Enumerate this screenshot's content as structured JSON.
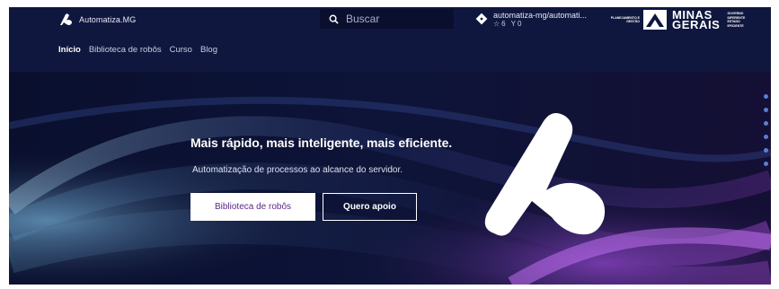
{
  "header": {
    "logo_text": "Automatiza.MG",
    "search": {
      "placeholder": "Buscar"
    },
    "repo": {
      "name": "automatiza-mg/automati...",
      "stars": "6",
      "forks": "0"
    },
    "partner": {
      "plan_text": "PLANEJAMENTO E GESTÃO",
      "brand_line1": "MINAS",
      "brand_line2": "GERAIS",
      "gov_text": "GOVERNO DIFERENTE ESTADO EFICIENTE"
    }
  },
  "nav": {
    "items": [
      {
        "label": "Início",
        "active": true
      },
      {
        "label": "Biblioteca de robôs"
      },
      {
        "label": "Curso"
      },
      {
        "label": "Blog"
      }
    ]
  },
  "hero": {
    "title": "Mais rápido, mais inteligente, mais eficiente.",
    "subtitle": "Automatização de processos ao alcance do servidor.",
    "primary_button": "Biblioteca de robôs",
    "secondary_button": "Quero apoio",
    "slide_count": 6
  },
  "colors": {
    "header_bg": "#10173f",
    "hero_bg": "#0d1233",
    "accent_purple": "#5b2a86",
    "dot": "#5b7fd0"
  }
}
